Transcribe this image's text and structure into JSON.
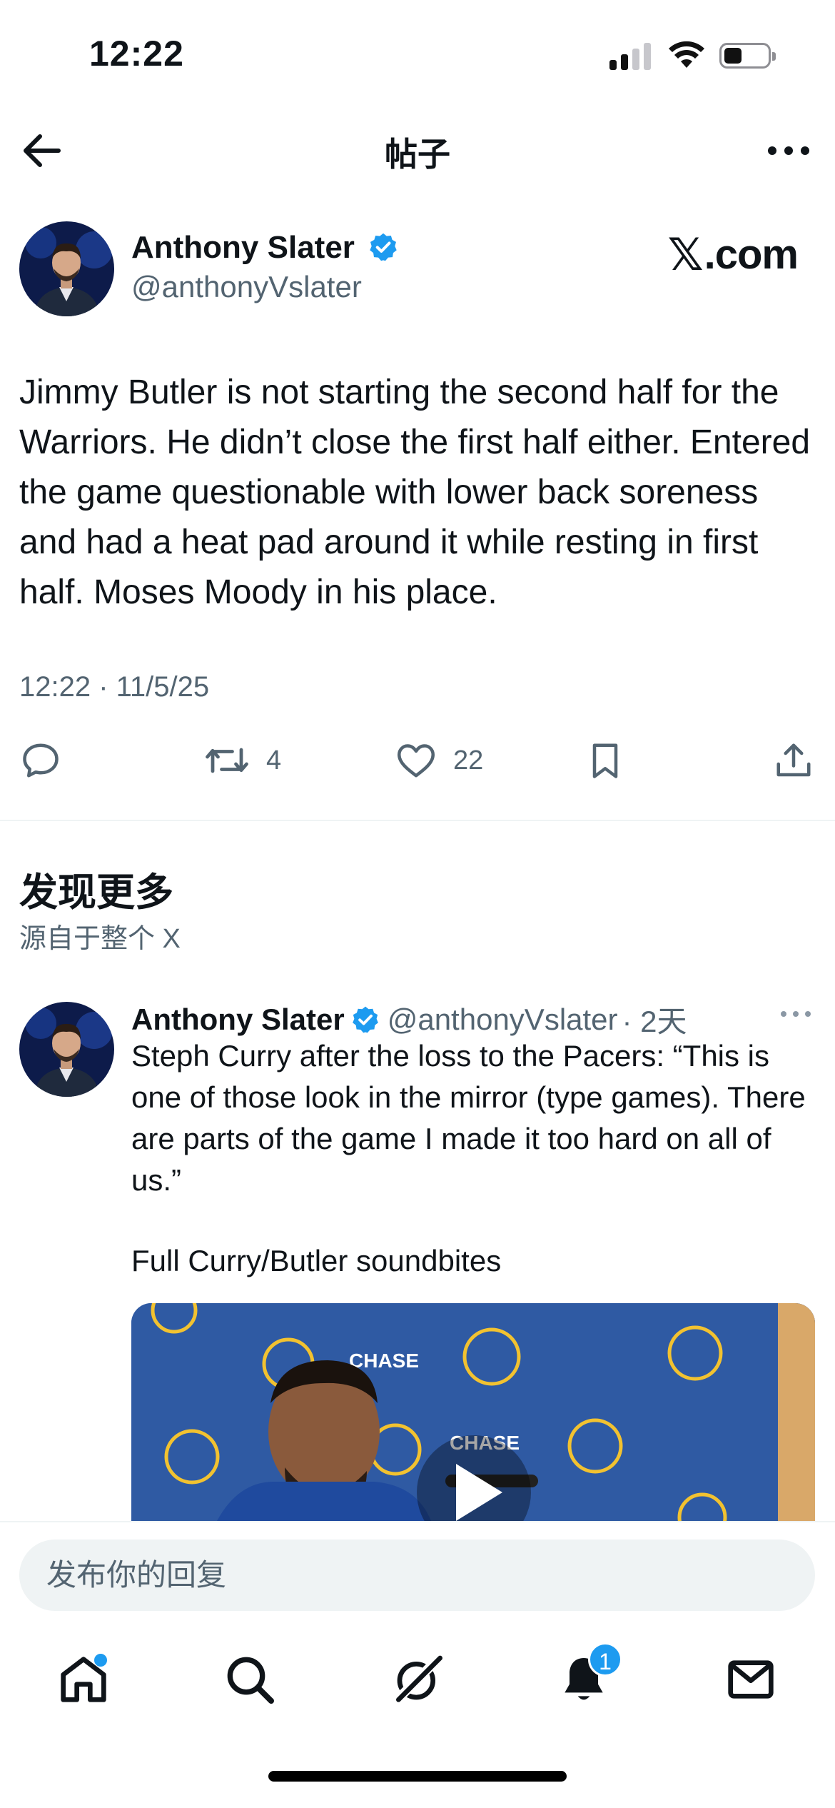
{
  "status_bar": {
    "time": "12:22"
  },
  "header": {
    "title": "帖子"
  },
  "main_tweet": {
    "author_name": "Anthony Slater",
    "author_handle": "@anthonyVslater",
    "source_brand": ".com",
    "text": "Jimmy Butler is not starting the second half for the Warriors. He didn’t close the first half either. Entered the game questionable with lower back soreness and had a heat pad around it while resting in first half. Moses Moody in his place.",
    "timestamp": "12:22 · 11/5/25",
    "stats": {
      "retweets": "4",
      "likes": "22"
    }
  },
  "discover": {
    "title": "发现更多",
    "subtitle": "源自于整个 X"
  },
  "second_tweet": {
    "author_name": "Anthony Slater",
    "author_handle": "@anthonyVslater",
    "age": "· 2天",
    "text": "Steph Curry after the loss to the Pacers: “This is one of those look in the mirror (type games). There are parts of the game I made it too hard on all of us.”",
    "extra_line": "Full Curry/Butler soundbites",
    "media_brand": "CHASE"
  },
  "reply": {
    "placeholder": "发布你的回复"
  },
  "bottom_nav": {
    "notifications_badge": "1"
  },
  "colors": {
    "accent": "#1d9bf0",
    "secondary_text": "#536471",
    "primary_text": "#0f1419"
  }
}
